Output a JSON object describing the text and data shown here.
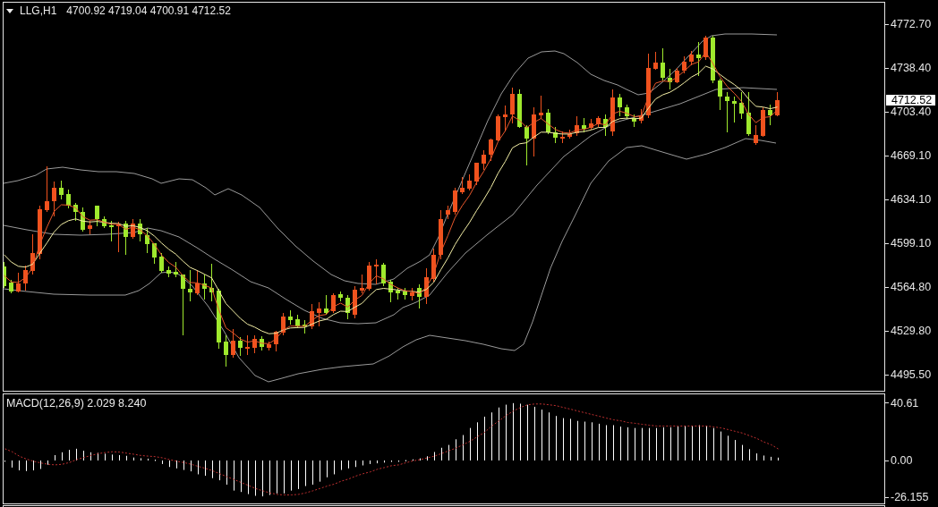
{
  "price_chart": {
    "symbol": "LLG,H1",
    "quote": "4700.92 4719.04 4700.91 4712.52",
    "price_axis": {
      "ticks": [
        "4772.70",
        "4738.40",
        "4703.40",
        "4669.10",
        "4634.10",
        "4599.10",
        "4564.80",
        "4529.80",
        "4495.50"
      ],
      "current_price": "4712.52"
    }
  },
  "macd_panel": {
    "title": "MACD(12,26,9) 2.029 8.240",
    "axis_ticks": [
      "40.61",
      "0.00",
      "-26.155"
    ]
  }
}
